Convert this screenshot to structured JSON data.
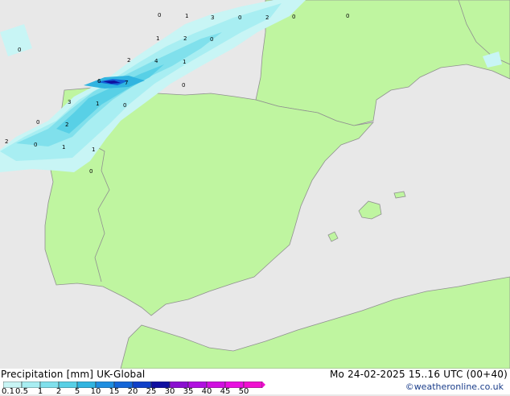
{
  "title": {
    "product": "Precipitation [mm]",
    "model": "UK-Global",
    "valid_time": "Mo 24-02-2025 15..16 UTC (00+40)",
    "credit": "©weatheronline.co.uk"
  },
  "legend": {
    "ticks": [
      "0.1",
      "0.5",
      "1",
      "2",
      "5",
      "10",
      "15",
      "20",
      "25",
      "30",
      "35",
      "40",
      "45",
      "50"
    ],
    "colors": [
      "#c8f5f5",
      "#a8eef2",
      "#80e0ec",
      "#58d0e6",
      "#30b4e0",
      "#1e8ee0",
      "#1466d8",
      "#1040c8",
      "#1010a0",
      "#8a10d0",
      "#b010e0",
      "#d010e0",
      "#e810e0",
      "#f010d0"
    ]
  },
  "colors": {
    "land": "#bff5a0",
    "sea": "#e8e8e8",
    "border": "#909090"
  },
  "map_values": [
    {
      "text": "0"
    },
    {
      "text": "1"
    },
    {
      "text": "3"
    },
    {
      "text": "0"
    },
    {
      "text": "2"
    },
    {
      "text": "0"
    },
    {
      "text": "0"
    },
    {
      "text": "1"
    },
    {
      "text": "2"
    },
    {
      "text": "0"
    },
    {
      "text": "0"
    },
    {
      "text": "2"
    },
    {
      "text": "4"
    },
    {
      "text": "1"
    },
    {
      "text": "6"
    },
    {
      "text": "7"
    },
    {
      "text": "0"
    },
    {
      "text": "3"
    },
    {
      "text": "1"
    },
    {
      "text": "0"
    },
    {
      "text": "0"
    },
    {
      "text": "2"
    },
    {
      "text": "2"
    },
    {
      "text": "0"
    },
    {
      "text": "1"
    },
    {
      "text": "1"
    },
    {
      "text": "0"
    }
  ]
}
